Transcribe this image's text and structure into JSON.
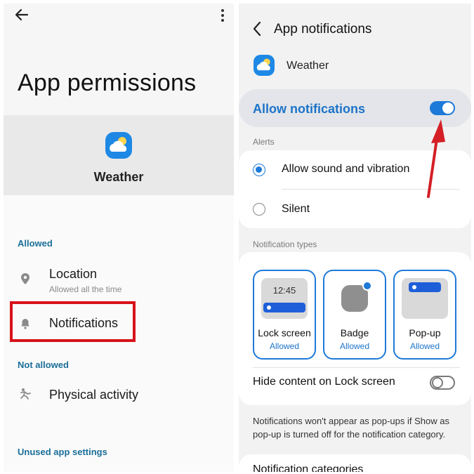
{
  "colors": {
    "accent_blue": "#1e7ad8",
    "section_label_teal": "#1a6f99",
    "highlight_red": "#d8121b",
    "arrow_red": "#d41f26"
  },
  "left": {
    "back_icon": "arrow-left-icon",
    "more_icon": "more-vertical-icon",
    "title": "App permissions",
    "app": {
      "name": "Weather",
      "icon": "weather-app-icon"
    },
    "allowed_label": "Allowed",
    "allowed_items": [
      {
        "title": "Location",
        "subtitle": "Allowed all the time",
        "icon": "location-pin-icon"
      },
      {
        "title": "Notifications",
        "icon": "bell-icon"
      }
    ],
    "not_allowed_label": "Not allowed",
    "not_allowed_items": [
      {
        "title": "Physical activity",
        "icon": "running-person-icon"
      }
    ],
    "unused_label": "Unused app settings"
  },
  "right": {
    "back_icon": "chevron-left-icon",
    "title": "App notifications",
    "app": {
      "name": "Weather",
      "icon": "weather-app-icon"
    },
    "allow_notifications": {
      "label": "Allow notifications",
      "enabled": true
    },
    "alerts_label": "Alerts",
    "alerts": [
      {
        "label": "Allow sound and vibration",
        "selected": true
      },
      {
        "label": "Silent",
        "selected": false
      }
    ],
    "types_label": "Notification types",
    "types": [
      {
        "name": "Lock screen",
        "status": "Allowed",
        "preview_time": "12:45"
      },
      {
        "name": "Badge",
        "status": "Allowed"
      },
      {
        "name": "Pop-up",
        "status": "Allowed"
      }
    ],
    "hide_content": {
      "label": "Hide content on Lock screen",
      "enabled": false
    },
    "note": "Notifications won't appear as pop-ups if Show as pop-up is turned off for the notification category.",
    "categories_label": "Notification categories"
  }
}
